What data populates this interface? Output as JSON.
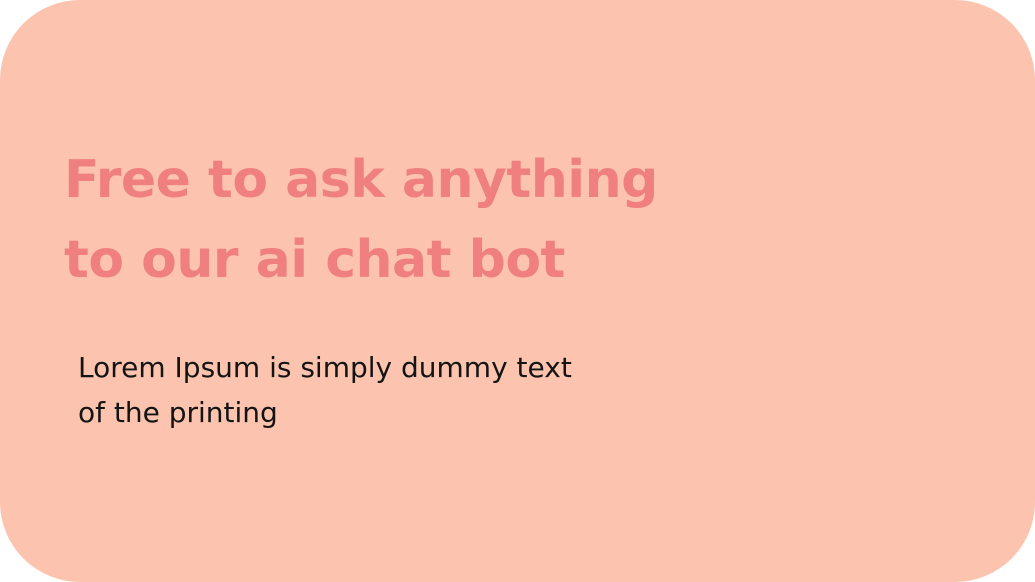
{
  "card": {
    "background_color": "#fcc4ae",
    "headline": {
      "line1": "Free to ask anything",
      "line2": "to our ai chat bot",
      "color": "#f08080"
    },
    "body": {
      "line1": "Lorem Ipsum is simply dummy text",
      "line2": "of the printing",
      "color": "#141414"
    }
  }
}
